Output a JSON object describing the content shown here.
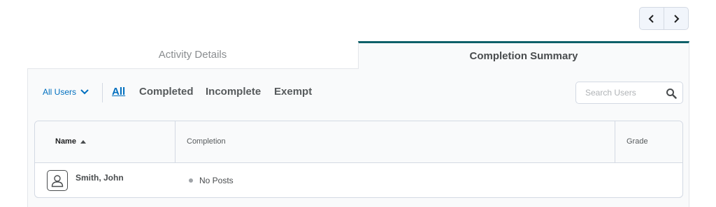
{
  "pager": {
    "prev_icon": "chevron-left-icon",
    "next_icon": "chevron-right-icon"
  },
  "tabs": [
    {
      "label": "Activity Details",
      "active": false
    },
    {
      "label": "Completion Summary",
      "active": true
    }
  ],
  "filters": {
    "users_dropdown": "All Users",
    "options": [
      "All",
      "Completed",
      "Incomplete",
      "Exempt"
    ],
    "selected": "All"
  },
  "search": {
    "placeholder": "Search Users",
    "value": ""
  },
  "table": {
    "columns": [
      "Name",
      "Completion",
      "Grade"
    ],
    "sort": {
      "column": "Name",
      "direction": "ascending"
    },
    "rows": [
      {
        "name": "Smith, John",
        "completion": "No Posts",
        "grade": ""
      }
    ]
  },
  "colors": {
    "accent": "#006fbf",
    "active_tab_border": "#0e6069",
    "status_dot": "#a0a4a8"
  }
}
